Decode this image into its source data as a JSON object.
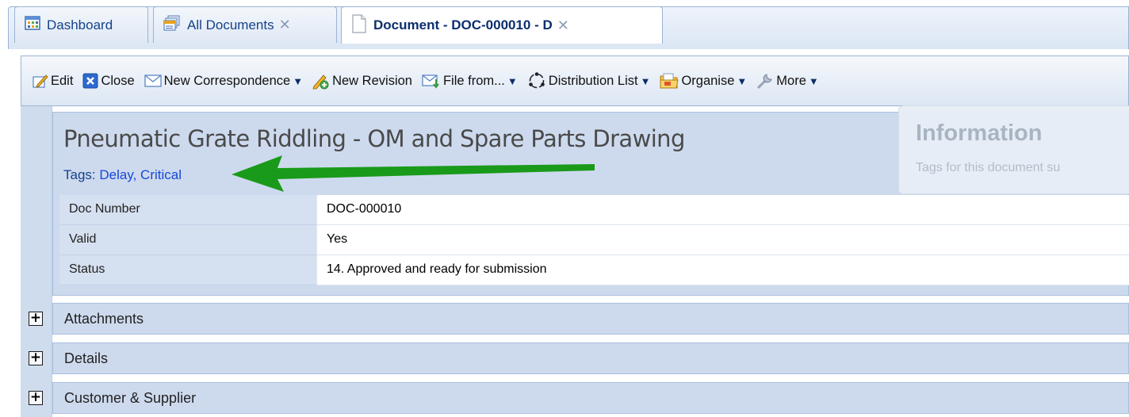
{
  "tabs": [
    {
      "label": "Dashboard",
      "icon": "dashboard-icon",
      "closable": false
    },
    {
      "label": "All Documents",
      "icon": "documents-icon",
      "closable": true
    },
    {
      "label": "Document - DOC-000010 - D",
      "icon": "document-icon",
      "closable": true,
      "active": true
    }
  ],
  "toolbar": {
    "edit": "Edit",
    "close": "Close",
    "new_correspondence": "New Correspondence",
    "new_revision": "New Revision",
    "file_from": "File from...",
    "distribution_list": "Distribution List",
    "organise": "Organise",
    "more": "More"
  },
  "document": {
    "title": "Pneumatic Grate Riddling - OM and Spare Parts Drawing",
    "tags_label": "Tags:",
    "tags": [
      "Delay",
      "Critical"
    ],
    "tag_separator": ","
  },
  "info": {
    "title": "Information",
    "subtitle": "Tags for this document su"
  },
  "properties": [
    {
      "label": "Doc Number",
      "value": "DOC-000010"
    },
    {
      "label": "Valid",
      "value": "Yes"
    },
    {
      "label": "Status",
      "value": "14. Approved and ready for submission"
    }
  ],
  "sections": [
    {
      "label": "Attachments",
      "toggle": "+"
    },
    {
      "label": "Details",
      "toggle": "+"
    },
    {
      "label": "Customer & Supplier",
      "toggle": "+"
    }
  ],
  "colors": {
    "annotation_arrow": "#1a9a1a",
    "tag_link": "#1847d6",
    "panel_bg": "#cddaee"
  }
}
